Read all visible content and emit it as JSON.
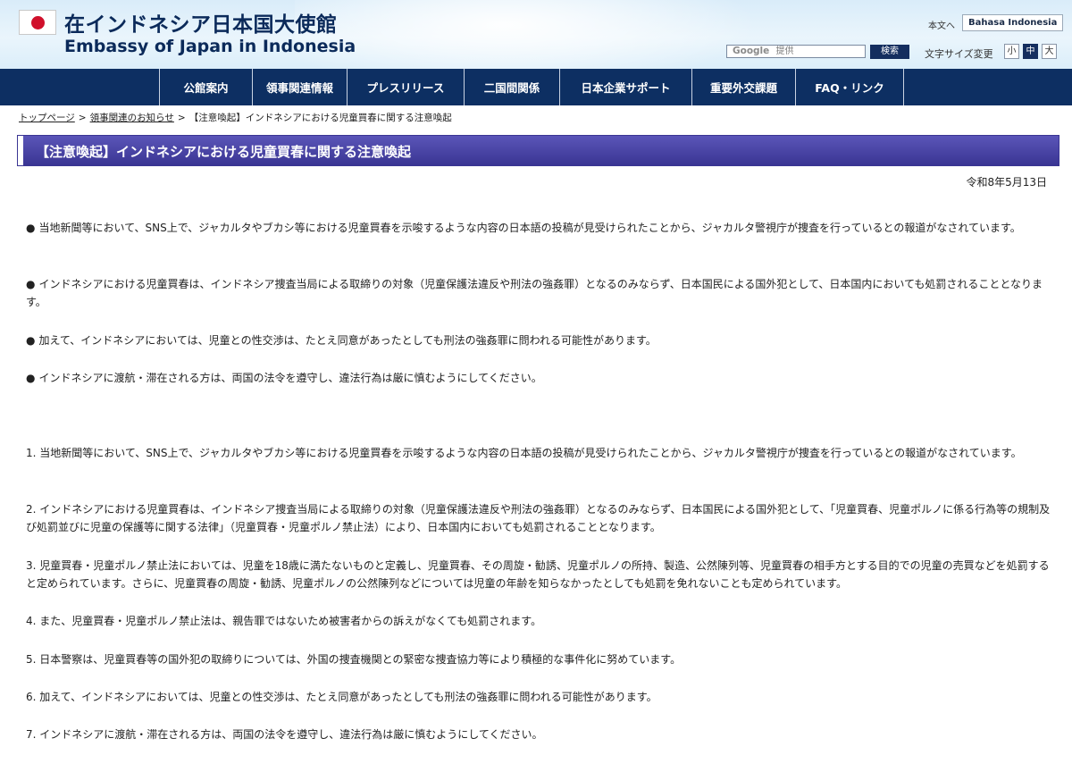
{
  "header": {
    "site_title_ja": "在インドネシア日本国大使館",
    "site_title_en": "Embassy of Japan in Indonesia",
    "skip_link": "本文へ",
    "lang_button": "Bahasa Indonesia",
    "search_brand": "Google",
    "search_placeholder": "提供",
    "search_button": "検索",
    "fontsize_label": "文字サイズ変更",
    "fontsize_options": [
      "小",
      "中",
      "大"
    ],
    "fontsize_selected": "中"
  },
  "nav": {
    "items": [
      "公館案内",
      "領事関連情報",
      "プレスリリース",
      "二国間関係",
      "日本企業サポート",
      "重要外交課題",
      "FAQ・リンク"
    ]
  },
  "breadcrumb": {
    "items": [
      "トップページ",
      "領事関連のお知らせ",
      "【注意喚起】インドネシアにおける児童買春に関する注意喚起"
    ],
    "separator": ">"
  },
  "page": {
    "title": "【注意喚起】インドネシアにおける児童買春に関する注意喚起",
    "date": "令和8年5月13日"
  },
  "bullets": [
    "当地新聞等において、SNS上で、ジャカルタやブカシ等における児童買春を示唆するような内容の日本語の投稿が見受けられたことから、ジャカルタ警視庁が捜査を行っているとの報道がなされています。",
    "インドネシアにおける児童買春は、インドネシア捜査当局による取締りの対象（児童保護法違反や刑法の強姦罪）となるのみならず、日本国民による国外犯として、日本国内においても処罰されることとなります。",
    "加えて、インドネシアにおいては、児童との性交渉は、たとえ同意があったとしても刑法の強姦罪に問われる可能性があります。",
    "インドネシアに渡航・滞在される方は、両国の法令を遵守し、違法行為は厳に慎むようにしてください。"
  ],
  "bullet_symbol": "●",
  "numbered": [
    "1.  当地新聞等において、SNS上で、ジャカルタやブカシ等における児童買春を示唆するような内容の日本語の投稿が見受けられたことから、ジャカルタ警視庁が捜査を行っているとの報道がなされています。",
    "2.  インドネシアにおける児童買春は、インドネシア捜査当局による取締りの対象（児童保護法違反や刑法の強姦罪）となるのみならず、日本国民による国外犯として、「児童買春、児童ポルノに係る行為等の規制及び処罰並びに児童の保護等に関する法律」（児童買春・児童ポルノ禁止法）により、日本国内においても処罰されることとなります。",
    "3.  児童買春・児童ポルノ禁止法においては、児童を18歳に満たないものと定義し、児童買春、その周旋・勧誘、児童ポルノの所持、製造、公然陳列等、児童買春の相手方とする目的での児童の売買などを処罰すると定められています。さらに、児童買春の周旋・勧誘、児童ポルノの公然陳列などについては児童の年齢を知らなかったとしても処罰を免れないことも定められています。",
    "4.  また、児童買春・児童ポルノ禁止法は、親告罪ではないため被害者からの訴えがなくても処罰されます。",
    "5.  日本警察は、児童買春等の国外犯の取締りについては、外国の捜査機関との緊密な捜査協力等により積極的な事件化に努めています。",
    "6.  加えて、インドネシアにおいては、児童との性交渉は、たとえ同意があったとしても刑法の強姦罪に問われる可能性があります。",
    "7.  インドネシアに渡航・滞在される方は、両国の法令を遵守し、違法行為は厳に慎むようにしてください。"
  ],
  "colors": {
    "nav_bg": "#0d2f62",
    "title_bar": "#4a45a8",
    "flag_red": "#d0102b"
  }
}
